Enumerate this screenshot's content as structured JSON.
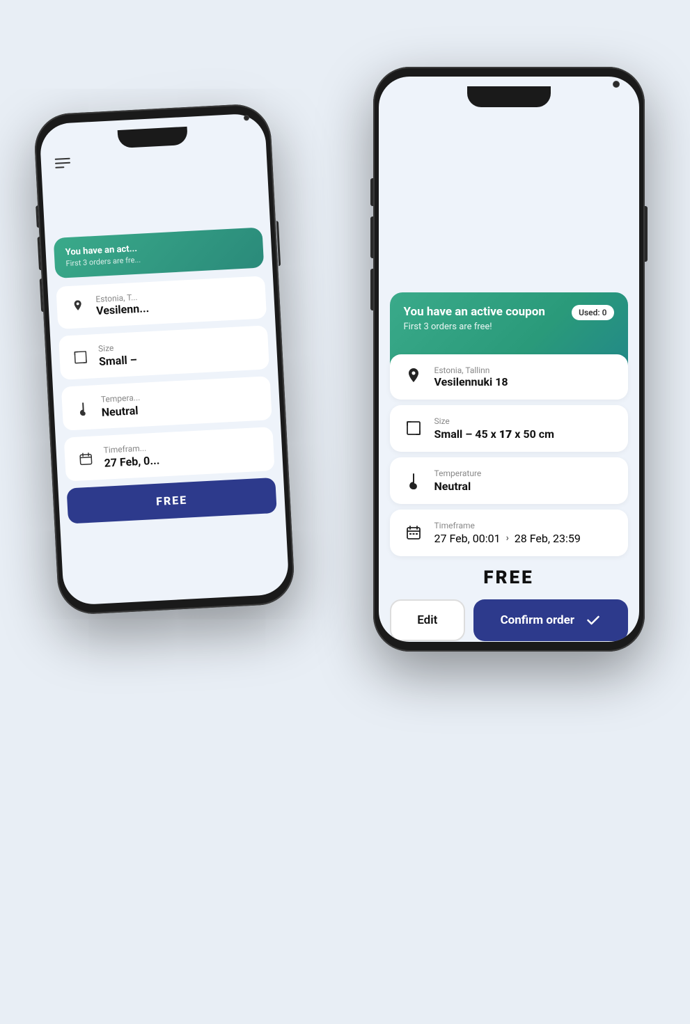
{
  "back_phone": {
    "menu_icon": "hamburger-menu",
    "coupon": {
      "title": "You have an act...",
      "subtitle": "First 3 orders are fre..."
    },
    "address": {
      "label": "Estonia, T...",
      "value": "Vesilenn..."
    },
    "size": {
      "label": "Size",
      "value": "Small –"
    },
    "temperature": {
      "label": "Tempera...",
      "value": "Neutral"
    },
    "timeframe": {
      "label": "Timefram...",
      "value": "27 Feb, 0..."
    },
    "price": "FREE"
  },
  "front_phone": {
    "coupon": {
      "title": "You have an active coupon",
      "subtitle": "First 3 orders are free!",
      "used_label": "Used: 0"
    },
    "address": {
      "label": "Estonia, Tallinn",
      "value": "Vesilennuki 18"
    },
    "size": {
      "label": "Size",
      "value_prefix": "Small",
      "value_dims": "– 45 x",
      "value_bold": "17",
      "value_suffix": "x 50 cm"
    },
    "temperature": {
      "label": "Temperature",
      "value": "Neutral"
    },
    "timeframe": {
      "label": "Timeframe",
      "from": "27 Feb, 00:01",
      "arrow": "›",
      "to": "28 Feb, 23:59"
    },
    "price": "FREE",
    "edit_button": "Edit",
    "confirm_button": "Confirm order",
    "check_icon": "checkmark"
  },
  "colors": {
    "coupon_gradient_start": "#3aaa8a",
    "coupon_gradient_end": "#228888",
    "confirm_button": "#2d3a8c",
    "background": "#eef3fa"
  }
}
